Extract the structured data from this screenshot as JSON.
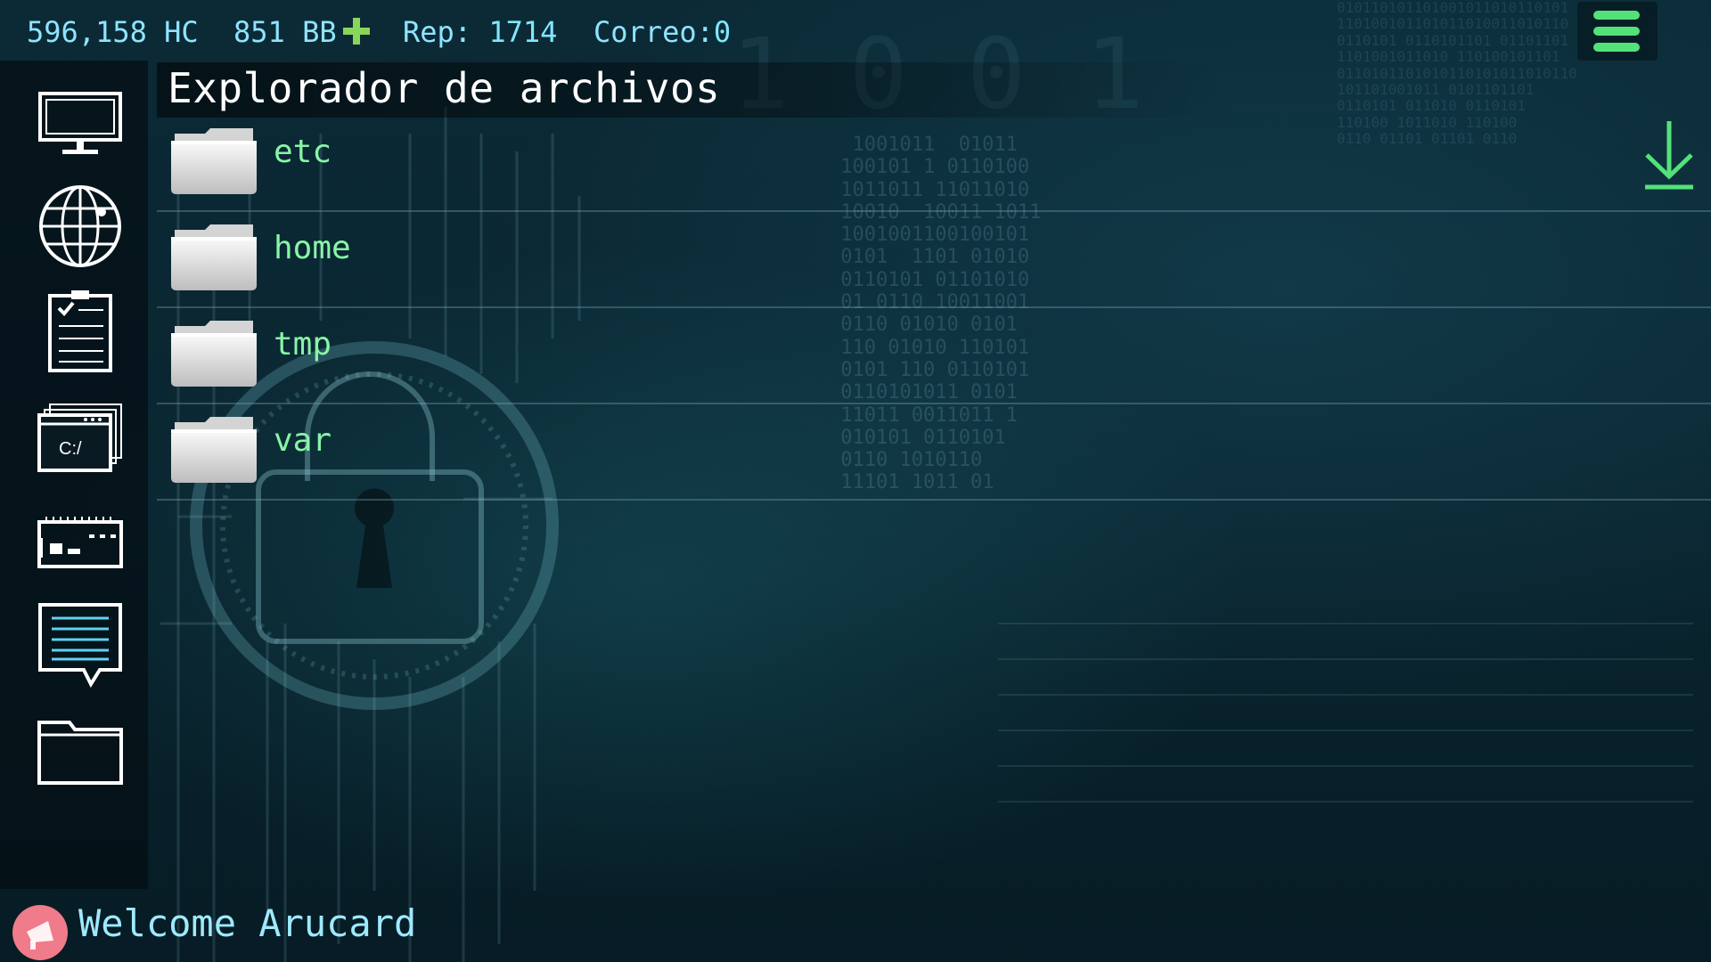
{
  "stats": {
    "hc": "596,158 HC",
    "bb": "851 BB",
    "rep_label": "Rep:",
    "rep_value": "1714",
    "mail_label": "Correo:",
    "mail_value": "0"
  },
  "explorer": {
    "title": "Explorador de archivos",
    "items": [
      {
        "name": "etc"
      },
      {
        "name": "home"
      },
      {
        "name": "tmp"
      },
      {
        "name": "var"
      }
    ]
  },
  "sidebar": {
    "items": [
      {
        "icon": "monitor-icon"
      },
      {
        "icon": "globe-icon"
      },
      {
        "icon": "clipboard-checklist-icon"
      },
      {
        "icon": "terminal-window-icon",
        "label": "C:/"
      },
      {
        "icon": "server-hardware-icon"
      },
      {
        "icon": "chat-message-icon"
      },
      {
        "icon": "folder-icon"
      }
    ]
  },
  "footer": {
    "welcome": "Welcome Arucard"
  },
  "colors": {
    "accent_green": "#53e27a",
    "stat_cyan": "#8fe4ff",
    "file_name_green": "#88f5a6",
    "avatar_pink": "#f07b8a"
  }
}
